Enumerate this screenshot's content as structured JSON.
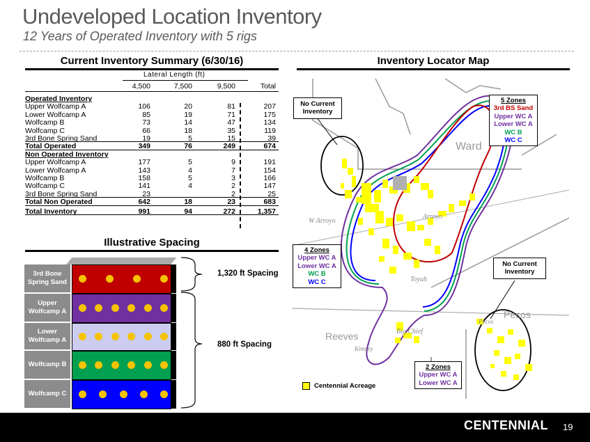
{
  "header": {
    "title": "Undeveloped Location Inventory",
    "subtitle": "12 Years of Operated Inventory with 5 rigs"
  },
  "summary": {
    "section_title": "Current Inventory Summary (6/30/16)",
    "group_header": "Lateral Length (ft)",
    "columns": [
      "4,500",
      "7,500",
      "9,500",
      "Total"
    ],
    "operated_heading": "Operated Inventory",
    "operated_rows": [
      {
        "label": "Upper Wolfcamp A",
        "values": [
          "106",
          "20",
          "81",
          "207"
        ]
      },
      {
        "label": "Lower Wolfcamp A",
        "values": [
          "85",
          "19",
          "71",
          "175"
        ]
      },
      {
        "label": "Wolfcamp B",
        "values": [
          "73",
          "14",
          "47",
          "134"
        ]
      },
      {
        "label": "Wolfcamp C",
        "values": [
          "66",
          "18",
          "35",
          "119"
        ]
      },
      {
        "label": "3rd Bone Spring Sand",
        "values": [
          "19",
          "5",
          "15",
          "39"
        ]
      }
    ],
    "operated_total": {
      "label": "Total Operated",
      "values": [
        "349",
        "76",
        "249",
        "674"
      ]
    },
    "non_operated_heading": "Non Operated Inventory",
    "non_operated_rows": [
      {
        "label": "Upper Wolfcamp A",
        "values": [
          "177",
          "5",
          "9",
          "191"
        ]
      },
      {
        "label": "Lower Wolfcamp A",
        "values": [
          "143",
          "4",
          "7",
          "154"
        ]
      },
      {
        "label": "Wolfcamp B",
        "values": [
          "158",
          "5",
          "3",
          "166"
        ]
      },
      {
        "label": "Wolfcamp C",
        "values": [
          "141",
          "4",
          "2",
          "147"
        ]
      },
      {
        "label": "3rd Bone Spring Sand",
        "values": [
          "23",
          "",
          "2",
          "25"
        ]
      }
    ],
    "non_operated_total": {
      "label": "Total Non Operated",
      "values": [
        "642",
        "18",
        "23",
        "683"
      ]
    },
    "grand_total": {
      "label": "Total Inventory",
      "values": [
        "991",
        "94",
        "272",
        "1,357"
      ]
    }
  },
  "spacing": {
    "section_title": "Illustrative Spacing",
    "layers": [
      {
        "label": "3rd Bone Spring Sand",
        "color": "#c00000",
        "dots": 4
      },
      {
        "label": "Upper Wolfcamp A",
        "color": "#7030a0",
        "dots": 6
      },
      {
        "label": "Lower Wolfcamp A",
        "color": "#ccccf0",
        "dots": 6
      },
      {
        "label": "Wolfcamp B",
        "color": "#00a050",
        "dots": 6
      },
      {
        "label": "Wolfcamp C",
        "color": "#0000ff",
        "dots": 5
      }
    ],
    "spacing_1": "1,320 ft Spacing",
    "spacing_2": "880 ft Spacing"
  },
  "map": {
    "section_title": "Inventory Locator Map",
    "callout_no_inventory_1": "No Current Inventory",
    "callout_no_inventory_2": "No Current Inventory",
    "callout_5_zones": {
      "title": "5 Zones",
      "lines": [
        "3rd BS Sand",
        "Upper WC A",
        "Lower WC A",
        "WC B",
        "WC C"
      ],
      "colors": [
        "#c00000",
        "#7030a0",
        "#7030a0",
        "#00a050",
        "#0000ff"
      ]
    },
    "callout_4_zones": {
      "title": "4 Zones",
      "lines": [
        "Upper WC A",
        "Lower WC A",
        "WC B",
        "WC C"
      ],
      "colors": [
        "#7030a0",
        "#7030a0",
        "#00a050",
        "#0000ff"
      ]
    },
    "callout_2_zones": {
      "title": "2 Zones",
      "lines": [
        "Upper WC A",
        "Lower WC A"
      ],
      "colors": [
        "#7030a0",
        "#7030a0"
      ]
    },
    "place_labels": [
      "Ward",
      "W Arroyo",
      "Arroyo",
      "Toyah",
      "Pecos",
      "Pecos",
      "Reeves",
      "Big Chief",
      "Kimsey"
    ],
    "legend": "Centennial Acreage",
    "acreage_color": "#ffff00"
  },
  "footer": {
    "logo": "CENTENNIAL",
    "page_number": "19"
  }
}
